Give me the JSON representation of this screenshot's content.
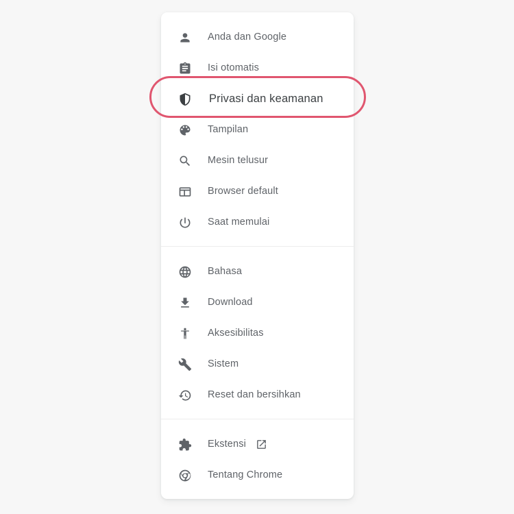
{
  "window": {
    "background_color": "#f7f7f7",
    "card_background_color": "#ffffff"
  },
  "highlight": {
    "target_label": "Privasi dan keamanan",
    "shape": "oval",
    "color": "#e0566f",
    "stroke_width_px": 3
  },
  "settings_menu": {
    "groups": [
      {
        "items": [
          {
            "icon": "person-icon",
            "label": "Anda dan Google",
            "highlighted": false,
            "trailing_icon": null
          },
          {
            "icon": "clipboard-icon",
            "label": "Isi otomatis",
            "highlighted": false,
            "trailing_icon": null
          },
          {
            "icon": "shield-icon",
            "label": "Privasi dan keamanan",
            "highlighted": true,
            "trailing_icon": null
          },
          {
            "icon": "palette-icon",
            "label": "Tampilan",
            "highlighted": false,
            "trailing_icon": null
          },
          {
            "icon": "search-icon",
            "label": "Mesin telusur",
            "highlighted": false,
            "trailing_icon": null
          },
          {
            "icon": "browser-window-icon",
            "label": "Browser default",
            "highlighted": false,
            "trailing_icon": null
          },
          {
            "icon": "power-icon",
            "label": "Saat memulai",
            "highlighted": false,
            "trailing_icon": null
          }
        ]
      },
      {
        "items": [
          {
            "icon": "globe-icon",
            "label": "Bahasa",
            "highlighted": false,
            "trailing_icon": null
          },
          {
            "icon": "download-icon",
            "label": "Download",
            "highlighted": false,
            "trailing_icon": null
          },
          {
            "icon": "accessibility-icon",
            "label": "Aksesibilitas",
            "highlighted": false,
            "trailing_icon": null
          },
          {
            "icon": "wrench-icon",
            "label": "Sistem",
            "highlighted": false,
            "trailing_icon": null
          },
          {
            "icon": "history-restore-icon",
            "label": "Reset dan bersihkan",
            "highlighted": false,
            "trailing_icon": null
          }
        ]
      },
      {
        "items": [
          {
            "icon": "puzzle-piece-icon",
            "label": "Ekstensi",
            "highlighted": false,
            "trailing_icon": "external-link-icon"
          },
          {
            "icon": "chrome-logo-icon",
            "label": "Tentang Chrome",
            "highlighted": false,
            "trailing_icon": null
          }
        ]
      }
    ]
  }
}
